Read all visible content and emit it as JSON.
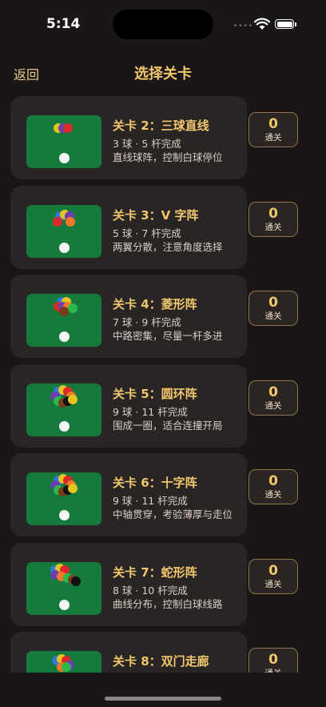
{
  "status": {
    "time": "5:14",
    "dots": "••••"
  },
  "nav": {
    "back_label": "返回",
    "title": "选择关卡"
  },
  "levels": [
    {
      "title": "关卡 2：三球直线",
      "meta": "3 球 · 5 杆完成",
      "desc": "直线球阵，控制白球停位",
      "score": "0",
      "score_label": "通关",
      "balls": [
        "#e8c21f",
        "#6a3fb0",
        "#d82a2a"
      ]
    },
    {
      "title": "关卡 3：V 字阵",
      "meta": "5 球 · 7 杆完成",
      "desc": "两翼分散，注意角度选择",
      "score": "0",
      "score_label": "通关",
      "balls": [
        "#2f7ad8",
        "#e8c21f",
        "#6a3fb0",
        "#d82a2a",
        "#f07a2a"
      ]
    },
    {
      "title": "关卡 4：菱形阵",
      "meta": "7 球 · 9 杆完成",
      "desc": "中路密集，尽量一杆多进",
      "score": "0",
      "score_label": "通关",
      "balls": [
        "#2f7ad8",
        "#e8c21f",
        "#d82a2a",
        "#6a3fb0",
        "#f07a2a",
        "#2db84a",
        "#7a3a1e"
      ]
    },
    {
      "title": "关卡 5：圆环阵",
      "meta": "9 球 · 11 杆完成",
      "desc": "围成一圈，适合连撞开局",
      "score": "0",
      "score_label": "通关",
      "balls": [
        "#2f7ad8",
        "#e8c21f",
        "#d82a2a",
        "#6a3fb0",
        "#f07a2a",
        "#2db84a",
        "#7a3a1e",
        "#111111",
        "#e8c21f"
      ]
    },
    {
      "title": "关卡 6：十字阵",
      "meta": "9 球 · 11 杆完成",
      "desc": "中轴贯穿，考验薄厚与走位",
      "score": "0",
      "score_label": "通关",
      "balls": [
        "#2f7ad8",
        "#e8c21f",
        "#d82a2a",
        "#6a3fb0",
        "#f07a2a",
        "#2db84a",
        "#7a3a1e",
        "#111111",
        "#e8c21f"
      ]
    },
    {
      "title": "关卡 7：蛇形阵",
      "meta": "8 球 · 10 杆完成",
      "desc": "曲线分布，控制白球线路",
      "score": "0",
      "score_label": "通关",
      "balls": [
        "#2f7ad8",
        "#e8c21f",
        "#d82a2a",
        "#6a3fb0",
        "#f07a2a",
        "#2db84a",
        "#7a3a1e",
        "#111111"
      ]
    },
    {
      "title": "关卡 8：双门走廊",
      "meta": "",
      "desc": "",
      "score": "0",
      "score_label": "通关",
      "balls": [
        "#2f7ad8",
        "#e8c21f",
        "#d82a2a",
        "#6a3fb0",
        "#f07a2a",
        "#2db84a"
      ]
    }
  ]
}
